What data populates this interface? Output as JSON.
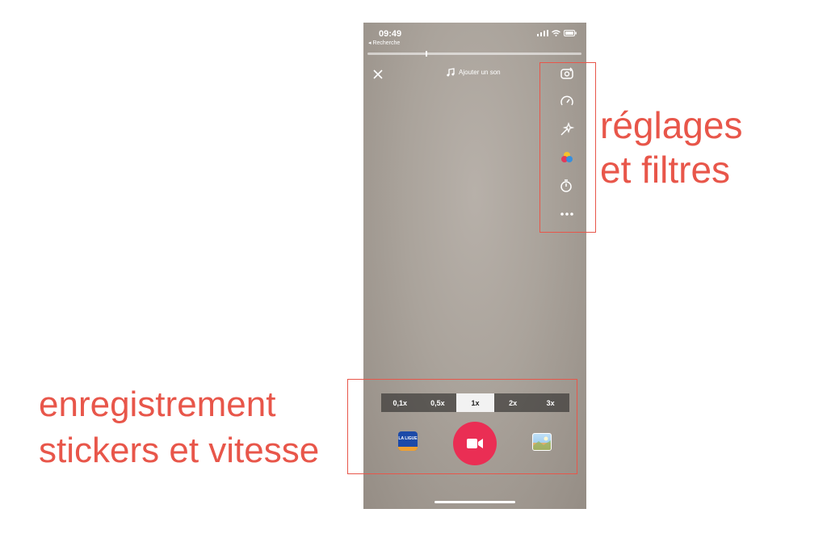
{
  "status_bar": {
    "time": "09:49",
    "back_label": "◂ Recherche"
  },
  "top_bar": {
    "add_sound_label": "Ajouter un son"
  },
  "tools": [
    {
      "name": "flip-camera-icon"
    },
    {
      "name": "speed-icon"
    },
    {
      "name": "beauty-icon"
    },
    {
      "name": "filters-icon"
    },
    {
      "name": "timer-icon"
    },
    {
      "name": "more-icon"
    }
  ],
  "speed_options": [
    "0,1x",
    "0,5x",
    "1x",
    "2x",
    "3x"
  ],
  "selected_speed": "1x",
  "sticker": {
    "text": "LA LIGUE"
  },
  "colors": {
    "accent": "#e8564a",
    "record": "#ea2e54"
  },
  "annotations": {
    "right": [
      "réglages",
      "et filtres"
    ],
    "left": [
      "enregistrement",
      "stickers et vitesse"
    ]
  }
}
